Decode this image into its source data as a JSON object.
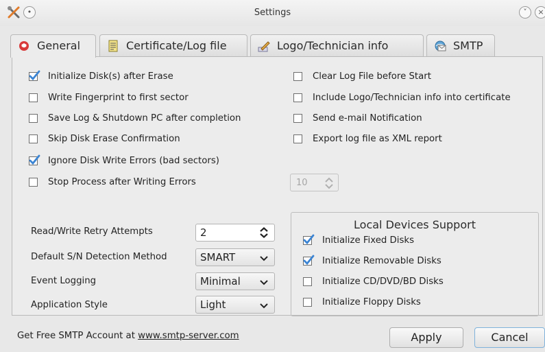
{
  "window": {
    "title": "Settings",
    "app_icon": "tools-icon",
    "buttons": {
      "minimize": "chevron-down-icon",
      "close": "close-icon",
      "menu": "menu-dot-icon"
    }
  },
  "tabs": [
    {
      "label": "General",
      "icon": "shield-icon",
      "active": true
    },
    {
      "label": "Certificate/Log file",
      "icon": "document-icon",
      "active": false
    },
    {
      "label": "Logo/Technician info",
      "icon": "pen-icon",
      "active": false
    },
    {
      "label": "SMTP",
      "icon": "mail-globe-icon",
      "active": false
    }
  ],
  "left_options": [
    {
      "label": "Initialize Disk(s) after Erase",
      "checked": true
    },
    {
      "label": "Write Fingerprint to first sector",
      "checked": false
    },
    {
      "label": "Save Log & Shutdown PC after completion",
      "checked": false
    },
    {
      "label": "Skip Disk Erase Confirmation",
      "checked": false
    },
    {
      "label": "Ignore Disk Write Errors (bad sectors)",
      "checked": true
    },
    {
      "label": "Stop Process after Writing Errors",
      "checked": false
    }
  ],
  "right_options": [
    {
      "label": "Clear Log File before Start",
      "checked": false
    },
    {
      "label": "Include Logo/Technician info into certificate",
      "checked": false
    },
    {
      "label": "Send e-mail Notification",
      "checked": false
    },
    {
      "label": "Export log file as XML report",
      "checked": false
    }
  ],
  "error_count": {
    "value": "10",
    "enabled": false
  },
  "fields": {
    "retry": {
      "label": "Read/Write Retry Attempts",
      "value": "2"
    },
    "sn_method": {
      "label": "Default S/N Detection Method",
      "value": "SMART"
    },
    "event_logging": {
      "label": "Event Logging",
      "value": "Minimal"
    },
    "app_style": {
      "label": "Application Style",
      "value": "Light"
    }
  },
  "local_devices": {
    "title": "Local Devices Support",
    "items": [
      {
        "label": "Initialize Fixed Disks",
        "checked": true
      },
      {
        "label": "Initialize Removable Disks",
        "checked": true
      },
      {
        "label": "Initialize CD/DVD/BD Disks",
        "checked": false
      },
      {
        "label": "Initialize Floppy Disks",
        "checked": false
      }
    ]
  },
  "footer": {
    "text": "Get Free SMTP Account at ",
    "link": "www.smtp-server.com",
    "apply": "Apply",
    "cancel": "Cancel"
  },
  "colors": {
    "check_blue": "#3b84d3",
    "check_accent": "#5bb0ea"
  }
}
